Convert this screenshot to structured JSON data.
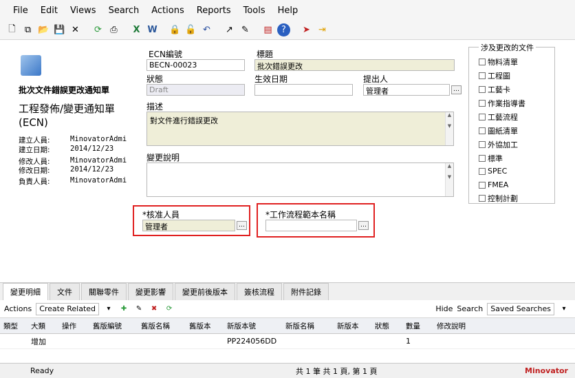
{
  "menu": [
    "File",
    "Edit",
    "Views",
    "Search",
    "Actions",
    "Reports",
    "Tools",
    "Help"
  ],
  "toolbar_icons": [
    "new-icon",
    "copy-icon",
    "open-icon",
    "save-icon",
    "close-icon",
    "refresh-icon",
    "print-icon",
    "excel-icon",
    "word-icon",
    "lock-icon",
    "unlock-icon",
    "undo-icon",
    "route-icon",
    "approve-icon",
    "report-icon",
    "help-icon",
    "send-icon",
    "exit-icon"
  ],
  "header": {
    "title": "批次文件錯誤更改通知單",
    "subtitle_line1": "工程發佈/變更通知單",
    "subtitle_line2": "(ECN)",
    "info": [
      {
        "k": "建立人員:",
        "v": "MinovatorAdmi"
      },
      {
        "k": "建立日期:",
        "v": "2014/12/23"
      },
      {
        "k": "修改人員:",
        "v": "MinovatorAdmi"
      },
      {
        "k": "修改日期:",
        "v": "2014/12/23"
      },
      {
        "k": "負責人員:",
        "v": "MinovatorAdmi"
      }
    ]
  },
  "fields": {
    "ecn_label": "ECN編號",
    "ecn_value": "BECN-00023",
    "title_label": "標題",
    "title_value": "批次錯誤更改",
    "status_label": "狀態",
    "status_value": "Draft",
    "effective_label": "生效日期",
    "effective_value": "",
    "proposer_label": "提出人",
    "proposer_value": "管理者",
    "description_label": "描述",
    "description_value": "對文件進行錯誤更改",
    "reason_label": "變更說明",
    "reason_value": "",
    "reviewer_label": "*核准人員",
    "reviewer_value": "管理者",
    "workflow_label": "*工作流程範本名稱",
    "workflow_value": ""
  },
  "affected_docs": {
    "title": "涉及更改的文件",
    "items": [
      "物料清單",
      "工程圖",
      "工藝卡",
      "作業指導書",
      "工藝流程",
      "圖紙清單",
      "外協加工",
      "標準",
      "SPEC",
      "FMEA",
      "控制計劃"
    ]
  },
  "tabs": [
    "變更明細",
    "文件",
    "關聯零件",
    "變更影響",
    "變更前後版本",
    "簽核流程",
    "附件記錄"
  ],
  "actions_bar": {
    "actions_label": "Actions",
    "select_value": "Create Related",
    "hide_label": "Hide",
    "search_label": "Search",
    "saved_searches_label": "Saved Searches"
  },
  "grid": {
    "columns": [
      "類型",
      "大類",
      "操作",
      "舊版編號",
      "舊版名稱",
      "舊版本",
      "新版本號",
      "新版名稱",
      "新版本",
      "狀態",
      "數量",
      "修改說明"
    ],
    "rows": [
      [
        "",
        "增加",
        "",
        "",
        "",
        "",
        "PP224056DD",
        "",
        "",
        "",
        "1",
        ""
      ]
    ]
  },
  "status": {
    "left": "Ready",
    "center": "共 1 筆 共 1 頁, 第 1 頁",
    "right": "Minovator"
  }
}
